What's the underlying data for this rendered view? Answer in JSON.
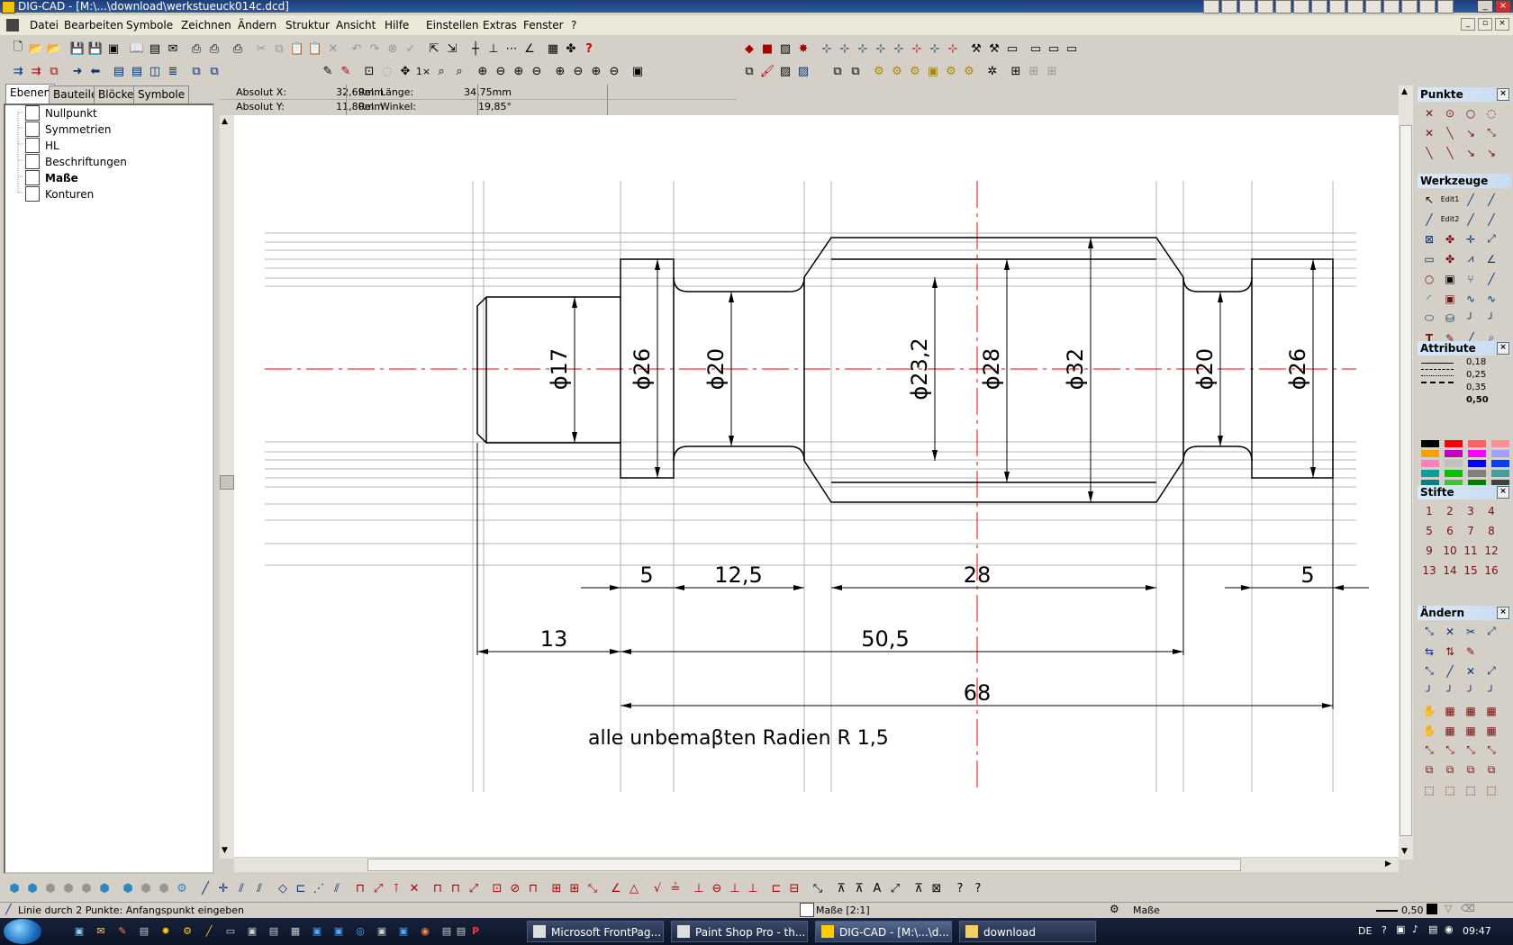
{
  "window": {
    "title": "DIG-CAD - [M:\\...\\download\\werkstueuck014c.dcd]"
  },
  "menu": [
    "Datei",
    "Bearbeiten",
    "Symbole",
    "Zeichnen",
    "Ändern",
    "Struktur",
    "Ansicht",
    "Hilfe",
    "Einstellen",
    "Extras",
    "Fenster",
    "?"
  ],
  "mdi_controls": [
    "_",
    "▫",
    "×"
  ],
  "left_tabs": [
    "Ebenen",
    "Bauteile",
    "Blöcke",
    "Symbole"
  ],
  "layers": [
    {
      "name": "Nullpunkt",
      "bold": false
    },
    {
      "name": "Symmetrien",
      "bold": false
    },
    {
      "name": "HL",
      "bold": false
    },
    {
      "name": "Beschriftungen",
      "bold": false
    },
    {
      "name": "Maße",
      "bold": true
    },
    {
      "name": "Konturen",
      "bold": false
    }
  ],
  "coords": {
    "abs_x_label": "Absolut X:",
    "abs_x": "32,69mm",
    "abs_y_label": "Absolut Y:",
    "abs_y": "11,80mm",
    "rel_len_label": "Rel. Länge:",
    "rel_len": "34,75mm",
    "rel_ang_label": "Rel. Winkel:",
    "rel_ang": "19,85°"
  },
  "drawing": {
    "dims": [
      "ϕ17",
      "ϕ26",
      "ϕ20",
      "ϕ23,2",
      "ϕ28",
      "ϕ32",
      "ϕ20",
      "ϕ26",
      "5",
      "12,5",
      "28",
      "5",
      "13",
      "50,5",
      "68"
    ],
    "note": "alle unbemaβten Radien R 1,5",
    "colors": {
      "centerline": "#ff0000",
      "line": "#000000",
      "helper": "#b4b4b4"
    }
  },
  "right_panel": {
    "sections": [
      "Punkte",
      "Werkzeuge",
      "Attribute",
      "Stifte",
      "Ändern"
    ],
    "line_weights": [
      "0,18",
      "0,25",
      "0,35",
      "0,50"
    ],
    "pens": [
      "1",
      "2",
      "3",
      "4",
      "5",
      "6",
      "7",
      "8",
      "9",
      "10",
      "11",
      "12",
      "13",
      "14",
      "15",
      "16"
    ],
    "palette": [
      "#000000",
      "#ff0000",
      "#ff6060",
      "#ff9090",
      "#ffa000",
      "#c000c0",
      "#ff00ff",
      "#a0a0ff",
      "#ff80c0",
      "#c0c0c0",
      "#0000ff",
      "#0040ff",
      "#00a0a0",
      "#00c000",
      "#808080",
      "#40a0a0",
      "#008080",
      "#40c040",
      "#008000",
      "#404040"
    ]
  },
  "status": {
    "hint": "Linie durch 2 Punkte: Anfangspunkt eingeben",
    "layer": "Maße [2:1]",
    "layer2": "Maße",
    "weight": "0,50"
  },
  "taskbar": {
    "tasks": [
      "Microsoft FrontPag...",
      "Paint Shop Pro - th...",
      "DIG-CAD - [M:\\...\\d...",
      "download"
    ],
    "lang": "DE",
    "time": "09:47"
  }
}
